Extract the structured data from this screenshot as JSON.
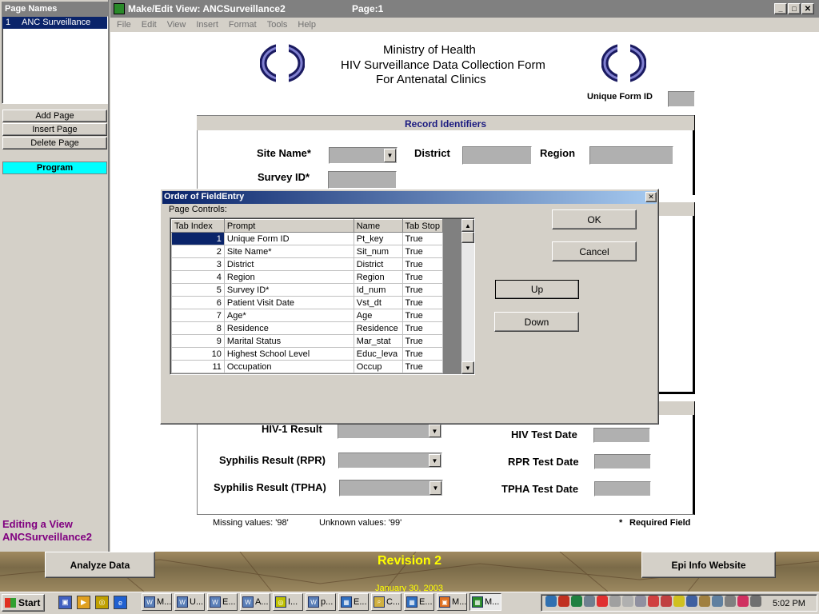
{
  "page_names_panel": {
    "title": "Page Names",
    "items": [
      {
        "num": "1",
        "label": "ANC Surveillance"
      }
    ],
    "buttons": {
      "add": "Add Page",
      "insert": "Insert Page",
      "delete": "Delete Page",
      "program": "Program"
    },
    "status_line1": "Editing a View",
    "status_line2": "ANCSurveillance2"
  },
  "window": {
    "title": "Make/Edit View: ANCSurveillance2",
    "page_label": "Page:1",
    "menu": [
      "File",
      "Edit",
      "View",
      "Insert",
      "Format",
      "Tools",
      "Help"
    ]
  },
  "form": {
    "title1": "Ministry of Health",
    "title2": "HIV Surveillance Data Collection Form",
    "title3": "For Antenatal Clinics",
    "unique_form_id": "Unique Form ID",
    "section1": "Record Identifiers",
    "site_name": "Site Name*",
    "district": "District",
    "region": "Region",
    "survey_id": "Survey ID*",
    "hiv1_result": "HIV-1 Result",
    "hiv_test_date": "HIV Test Date",
    "syph_rpr": "Syphilis Result (RPR)",
    "rpr_test_date": "RPR Test Date",
    "syph_tpha": "Syphilis Result (TPHA)",
    "tpha_test_date": "TPHA Test Date",
    "missing": "Missing values: '98'",
    "unknown": "Unknown values: '99'",
    "required_star": "*",
    "required": "Required Field"
  },
  "dialog": {
    "title": "Order of FieldEntry",
    "page_controls": "Page Controls:",
    "columns": [
      "Tab Index",
      "Prompt",
      "Name",
      "Tab Stop"
    ],
    "rows": [
      [
        "1",
        "Unique Form ID",
        "Pt_key",
        "True"
      ],
      [
        "2",
        "Site Name*",
        "Sit_num",
        "True"
      ],
      [
        "3",
        "District",
        "District",
        "True"
      ],
      [
        "4",
        "Region",
        "Region",
        "True"
      ],
      [
        "5",
        "Survey ID*",
        "Id_num",
        "True"
      ],
      [
        "6",
        "Patient Visit Date",
        "Vst_dt",
        "True"
      ],
      [
        "7",
        "Age*",
        "Age",
        "True"
      ],
      [
        "8",
        "Residence",
        "Residence",
        "True"
      ],
      [
        "9",
        "Marital Status",
        "Mar_stat",
        "True"
      ],
      [
        "10",
        "Highest School Level",
        "Educ_leva",
        "True"
      ],
      [
        "11",
        "Occupation",
        "Occup",
        "True"
      ]
    ],
    "ok": "OK",
    "cancel": "Cancel",
    "up": "Up",
    "down": "Down"
  },
  "bottom_bar": {
    "analyze": "Analyze Data",
    "revision": "Revision 2",
    "date": "January 30, 2003",
    "website": "Epi Info Website"
  },
  "taskbar": {
    "start": "Start",
    "tasks": [
      "M...",
      "U...",
      "E...",
      "A...",
      "I...",
      "p...",
      "E...",
      "C...",
      "E...",
      "M...",
      "M..."
    ],
    "clock": "5:02 PM"
  }
}
